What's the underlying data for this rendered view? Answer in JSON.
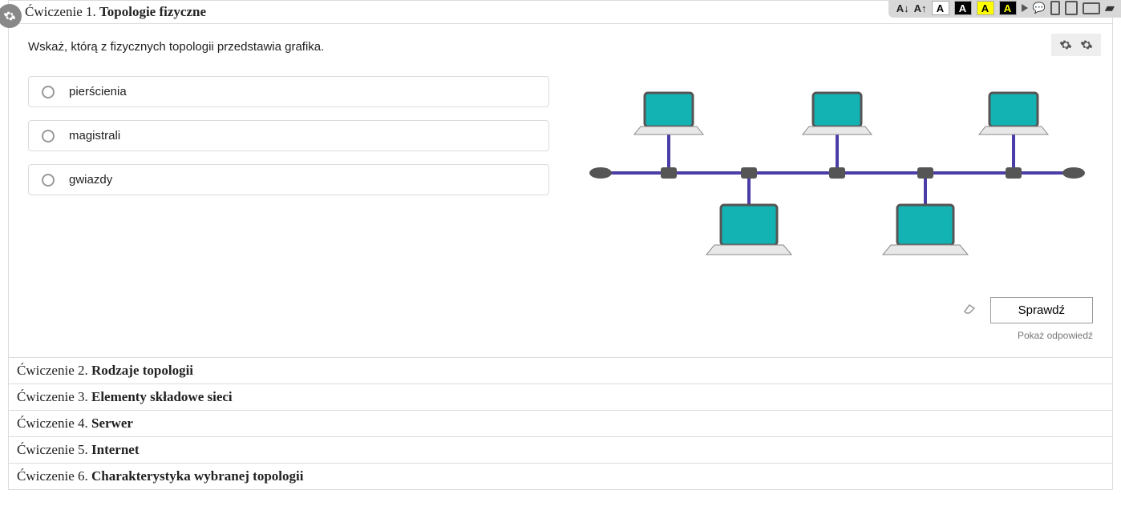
{
  "toolbar": {
    "decrease": "A↓",
    "increase": "A↑",
    "letter": "A"
  },
  "exercise1": {
    "prefix": "Ćwiczenie 1. ",
    "title": "Topologie fizyczne",
    "question": "Wskaż, którą z fizycznych topologii przedstawia grafika.",
    "options": [
      "pierścienia",
      "magistrali",
      "gwiazdy"
    ],
    "check_label": "Sprawdź",
    "show_answer": "Pokaż odpowiedź"
  },
  "others": [
    {
      "prefix": "Ćwiczenie 2. ",
      "title": "Rodzaje topologii"
    },
    {
      "prefix": "Ćwiczenie 3. ",
      "title": "Elementy składowe sieci"
    },
    {
      "prefix": "Ćwiczenie 4. ",
      "title": "Serwer"
    },
    {
      "prefix": "Ćwiczenie 5. ",
      "title": "Internet"
    },
    {
      "prefix": "Ćwiczenie 6. ",
      "title": "Charakterystyka wybranej topologii"
    }
  ]
}
